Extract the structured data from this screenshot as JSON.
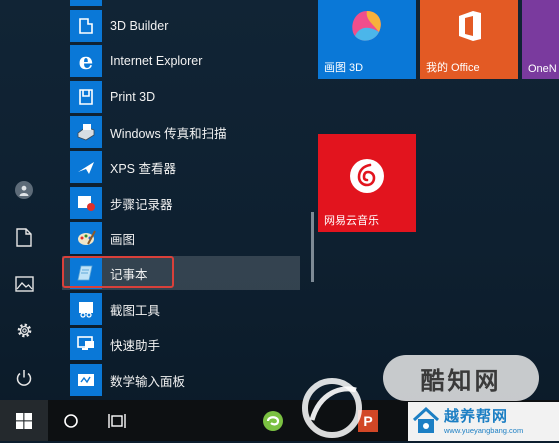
{
  "apps": [
    {
      "label": "3D Builder",
      "icon": "3d-builder-icon"
    },
    {
      "label": "Internet Explorer",
      "icon": "internet-explorer-icon"
    },
    {
      "label": "Print 3D",
      "icon": "print-3d-icon"
    },
    {
      "label": "Windows 传真和扫描",
      "icon": "fax-scan-icon"
    },
    {
      "label": "XPS 查看器",
      "icon": "xps-viewer-icon"
    },
    {
      "label": "步骤记录器",
      "icon": "steps-recorder-icon"
    },
    {
      "label": "画图",
      "icon": "paint-icon"
    },
    {
      "label": "记事本",
      "icon": "notepad-icon"
    },
    {
      "label": "截图工具",
      "icon": "snipping-tool-icon"
    },
    {
      "label": "快速助手",
      "icon": "quick-assist-icon"
    },
    {
      "label": "数学输入面板",
      "icon": "math-input-icon"
    }
  ],
  "tiles": {
    "paint3d": "画图 3D",
    "office": "我的 Office",
    "onenote": "OneN",
    "netease": "网易云音乐"
  },
  "colors": {
    "accent": "#0a78d7",
    "office": "#e35a24",
    "netease": "#e2141e",
    "highlight_box": "#d9403a"
  },
  "watermarks": {
    "site1": "酷知网",
    "site2": "越养帮网",
    "site2_url": "www.yueyangbang.com"
  }
}
